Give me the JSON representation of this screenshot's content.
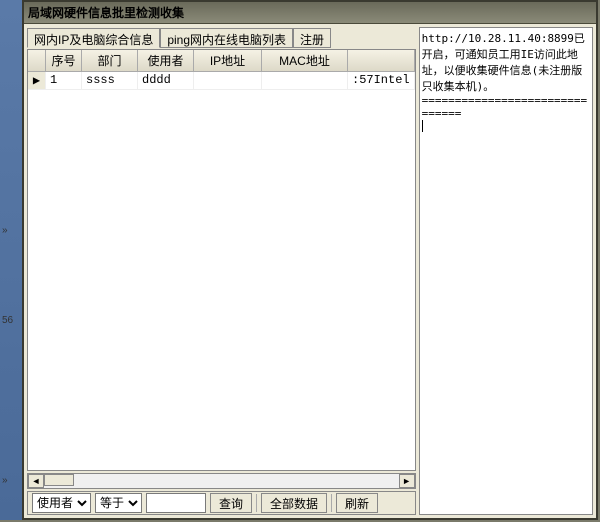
{
  "window": {
    "title": "局域网硬件信息批里检测收集"
  },
  "tabs": {
    "tab1": "网内IP及电脑综合信息",
    "tab2": "ping网内在线电脑列表",
    "tab3": "注册"
  },
  "grid": {
    "headers": {
      "seq": "序号",
      "dept": "部门",
      "user": "使用者",
      "ip": "IP地址",
      "mac": "MAC地址"
    },
    "rows": [
      {
        "seq": "1",
        "dept": "ssss",
        "user": "dddd",
        "ip": "",
        "mac": "",
        "rest": ":57Intel"
      }
    ]
  },
  "toolbar": {
    "field_options": [
      "使用者"
    ],
    "field_value": "使用者",
    "op_options": [
      "等于"
    ],
    "op_value": "等于",
    "input_value": "",
    "btn_query": "查询",
    "btn_all": "全部数据",
    "btn_refresh": "刷新"
  },
  "memo": {
    "text": "http://10.28.11.40:8899已开启，可通知员工用IE访问此地址，以便收集硬件信息(未注册版只收集本机)。\n==============================="
  },
  "leftstrip": {
    "m1": "»",
    "m2": "56",
    "m3": "»"
  }
}
